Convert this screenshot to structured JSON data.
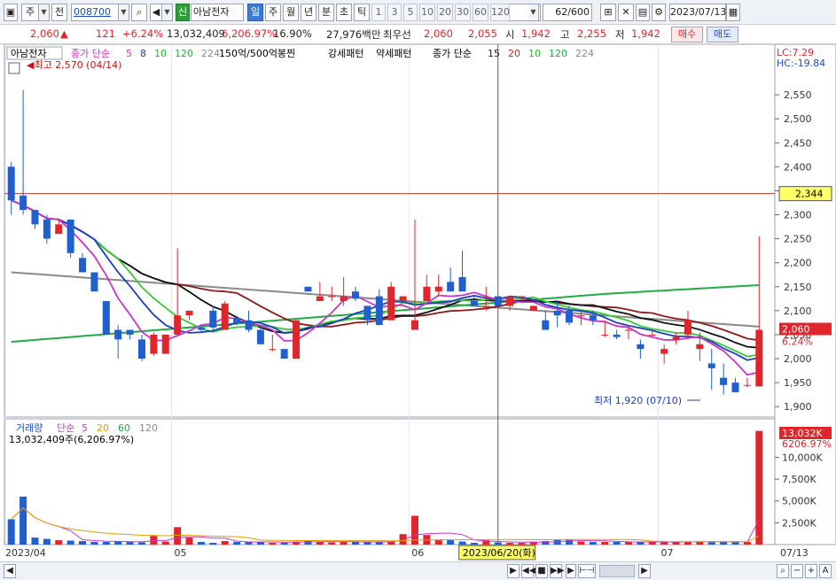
{
  "toolbar": {
    "market": "주",
    "prev": "전",
    "code": "008700",
    "new_badge": "신",
    "stock_name": "아남전자",
    "periods": [
      "일",
      "주",
      "월",
      "년",
      "분",
      "초",
      "틱"
    ],
    "active_period": "일",
    "intervals": [
      "1",
      "3",
      "5",
      "10",
      "20",
      "30",
      "60",
      "120"
    ],
    "count": "62",
    "count_total": "/600",
    "date": "2023/07/13"
  },
  "quote": {
    "price": "2,060",
    "change_arrow": "▲",
    "change": "121",
    "change_pct": "+6.24%",
    "volume": "13,032,409",
    "volume_ratio": "6,206.97%",
    "turnover": "16.90%",
    "amount": "27,976백만",
    "bid_label": "최우선",
    "best_ask": "2,060",
    "best_bid": "2,055",
    "open_label": "시",
    "open": "1,942",
    "high_label": "고",
    "high": "2,255",
    "low_label": "저",
    "low": "1,942",
    "buy_button": "매수",
    "sell_button": "매도"
  },
  "legend": {
    "stock": "아남전자",
    "ma_label": "종가 단순",
    "ma_periods": [
      "5",
      "8",
      "10",
      "120",
      "224"
    ],
    "ma_colors": [
      "#cc33cc",
      "#1a3fbf",
      "#22bb22",
      "#22aa44",
      "#888888"
    ],
    "pattern1": "150억/500억봉찐",
    "pattern2": "강세패턴",
    "pattern3": "약세패턴",
    "ma2_label": "종가 단순",
    "ma2_periods": [
      "15",
      "20",
      "10",
      "120",
      "224"
    ],
    "ma2_colors": [
      "#222222",
      "#cc2222",
      "#22bb22",
      "#22aa44",
      "#888888"
    ],
    "lc": "LC:7.29",
    "hc": "HC:-19.84",
    "max_label": "최고 2,570 (04/14)",
    "min_label": "최저 1,920 (07/10)"
  },
  "price_axis": [
    "2,550",
    "2,500",
    "2,450",
    "2,400",
    "2,350",
    "2,300",
    "2,250",
    "2,200",
    "2,150",
    "2,100",
    "2,050",
    "2,000",
    "1,950",
    "1,900"
  ],
  "crosshair_price": "2,344",
  "last_price_tag": "2,060",
  "last_pct_tag": "6.24%",
  "volume_panel": {
    "title": "거래량",
    "ma_label": "단순",
    "ma_periods": [
      "5",
      "20",
      "60",
      "120"
    ],
    "ma_colors": [
      "#cc33cc",
      "#e0a000",
      "#22aa44",
      "#888888"
    ],
    "value_text": "13,032,409주(6,206.97%)",
    "axis": [
      "10,000K",
      "7,500K",
      "5,000K",
      "2,500K"
    ],
    "last_tag": "13,032K",
    "last_pct_tag": "6206.97%"
  },
  "x_axis": {
    "labels": [
      "2023/04",
      "05",
      "06",
      "07",
      "07/13"
    ],
    "crosshair_date": "2023/06/20(화)"
  },
  "chart_data": {
    "type": "candlestick",
    "candles": [
      [
        2400,
        2410,
        2300,
        2330
      ],
      [
        2340,
        2560,
        2300,
        2310
      ],
      [
        2310,
        2310,
        2270,
        2280
      ],
      [
        2290,
        2300,
        2240,
        2250
      ],
      [
        2260,
        2290,
        2260,
        2280
      ],
      [
        2290,
        2290,
        2210,
        2220
      ],
      [
        2210,
        2220,
        2180,
        2180
      ],
      [
        2180,
        2180,
        2140,
        2140
      ],
      [
        2120,
        2120,
        2050,
        2050
      ],
      [
        2060,
        2070,
        2000,
        2040
      ],
      [
        2060,
        2060,
        2040,
        2050
      ],
      [
        2040,
        2050,
        1995,
        2000
      ],
      [
        2010,
        2055,
        2005,
        2050
      ],
      [
        2010,
        2050,
        2010,
        2050
      ],
      [
        2050,
        2230,
        2050,
        2090
      ],
      [
        2090,
        2100,
        2080,
        2100
      ],
      [
        2065,
        2070,
        2055,
        2060
      ],
      [
        2100,
        2110,
        2060,
        2065
      ],
      [
        2060,
        2120,
        2060,
        2115
      ],
      [
        2085,
        2090,
        2070,
        2075
      ],
      [
        2080,
        2100,
        2055,
        2060
      ],
      [
        2060,
        2070,
        2030,
        2030
      ],
      [
        2020,
        2050,
        2015,
        2020
      ],
      [
        2020,
        2020,
        2000,
        2000
      ],
      [
        2000,
        2080,
        2000,
        2080
      ],
      [
        2150,
        2150,
        2140,
        2140
      ],
      [
        2120,
        2160,
        2120,
        2130
      ],
      [
        2130,
        2150,
        2120,
        2130
      ],
      [
        2120,
        2170,
        2110,
        2130
      ],
      [
        2140,
        2150,
        2120,
        2125
      ],
      [
        2110,
        2110,
        2070,
        2080
      ],
      [
        2130,
        2145,
        2070,
        2070
      ],
      [
        2080,
        2160,
        2090,
        2150
      ],
      [
        2120,
        2130,
        2120,
        2130
      ],
      [
        2060,
        2290,
        2060,
        2080
      ],
      [
        2120,
        2175,
        2120,
        2150
      ],
      [
        2140,
        2175,
        2130,
        2150
      ],
      [
        2160,
        2190,
        2140,
        2140
      ],
      [
        2170,
        2225,
        2140,
        2140
      ],
      [
        2120,
        2130,
        2110,
        2110
      ],
      [
        2110,
        2150,
        2100,
        2110
      ],
      [
        2130,
        2130,
        2110,
        2110
      ],
      [
        2110,
        2130,
        2100,
        2130
      ],
      [
        2130,
        2130,
        2120,
        2130
      ],
      [
        2100,
        2110,
        2100,
        2110
      ],
      [
        2080,
        2100,
        2060,
        2060
      ],
      [
        2100,
        2120,
        2065,
        2090
      ],
      [
        2100,
        2110,
        2070,
        2075
      ],
      [
        2090,
        2100,
        2070,
        2090
      ],
      [
        2090,
        2100,
        2070,
        2080
      ],
      [
        2050,
        2080,
        2045,
        2050
      ],
      [
        2050,
        2060,
        2040,
        2045
      ],
      [
        2060,
        2070,
        2040,
        2060
      ],
      [
        2030,
        2040,
        2000,
        2020
      ],
      [
        2050,
        2060,
        2045,
        2050
      ],
      [
        2010,
        2030,
        1990,
        2020
      ],
      [
        2040,
        2055,
        2030,
        2045
      ],
      [
        2050,
        2100,
        2040,
        2080
      ],
      [
        2020,
        2055,
        1995,
        2030
      ],
      [
        1990,
        2020,
        1935,
        1980
      ],
      [
        1960,
        1990,
        1925,
        1945
      ],
      [
        1950,
        1960,
        1930,
        1930
      ],
      [
        1945,
        1960,
        1940,
        1945
      ],
      [
        1942,
        2255,
        1942,
        2060
      ]
    ],
    "volume_k": [
      2900,
      5500,
      800,
      650,
      500,
      450,
      400,
      300,
      300,
      400,
      300,
      250,
      1000,
      350,
      2000,
      800,
      300,
      200,
      400,
      300,
      300,
      300,
      200,
      200,
      350,
      500,
      300,
      250,
      300,
      350,
      300,
      300,
      350,
      1200,
      3300,
      1100,
      500,
      500,
      350,
      200,
      500,
      250,
      200,
      200,
      300,
      400,
      600,
      600,
      350,
      300,
      300,
      300,
      300,
      300,
      300,
      300,
      300,
      350,
      350,
      300,
      300,
      300,
      300,
      13032
    ],
    "ylim": [
      1880,
      2600
    ],
    "vol_ylim": [
      0,
      13500
    ]
  }
}
